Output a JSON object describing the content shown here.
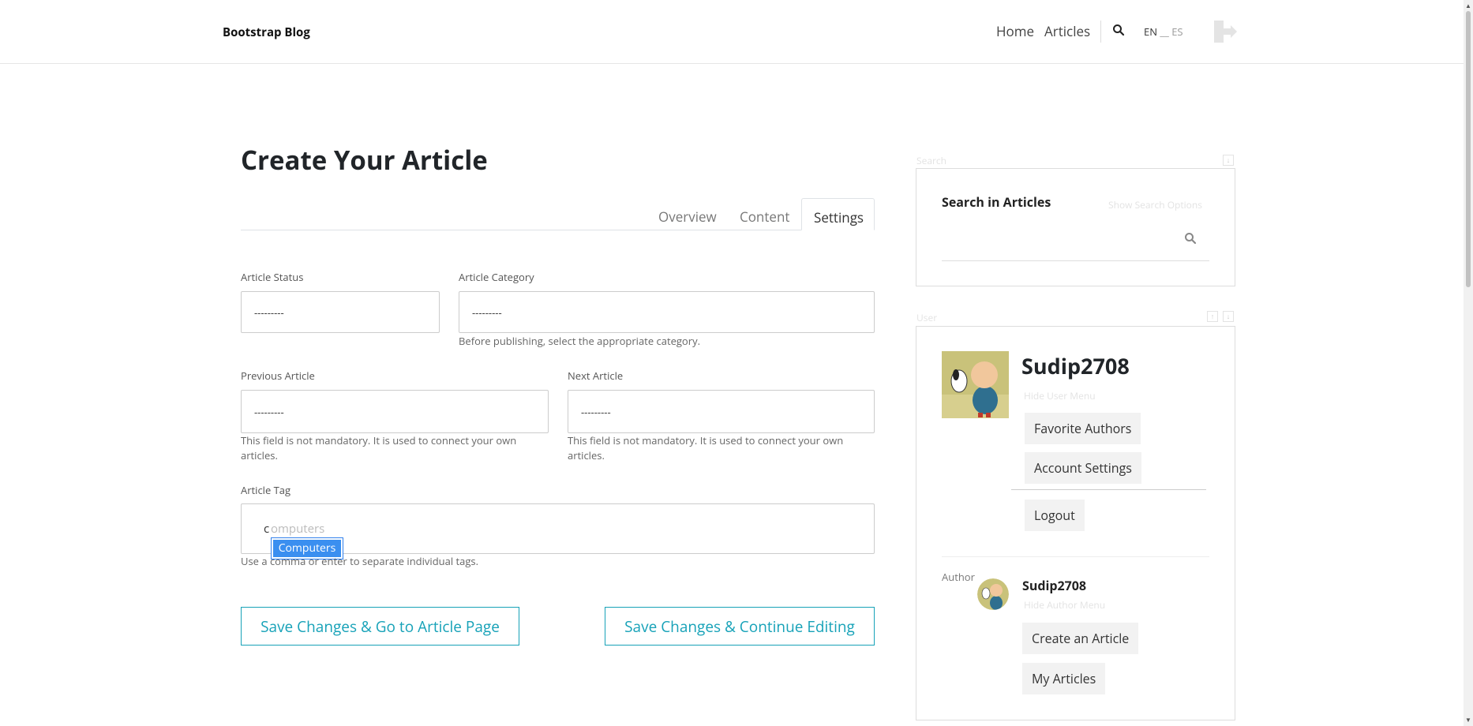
{
  "header": {
    "brand": "Bootstrap Blog",
    "nav": [
      "Home",
      "Articles"
    ],
    "lang_en": "EN",
    "lang_sep": "__",
    "lang_es": "ES"
  },
  "page": {
    "title": "Create Your Article",
    "tabs": [
      "Overview",
      "Content",
      "Settings"
    ],
    "active_tab": "Settings"
  },
  "form": {
    "status_label": "Article Status",
    "status_value": "---------",
    "category_label": "Article Category",
    "category_value": "---------",
    "category_help": "Before publishing, select the appropriate category.",
    "prev_label": "Previous Article",
    "prev_value": "---------",
    "prev_help": "This field is not mandatory. It is used to connect your own articles.",
    "next_label": "Next Article",
    "next_value": "---------",
    "next_help": "This field is not mandatory. It is used to connect your own articles.",
    "tag_label": "Article Tag",
    "tag_typed": "c",
    "tag_ghost": "omputers",
    "tag_suggestion": "Computers",
    "tag_help": "Use a comma or enter to separate individual tags."
  },
  "actions": {
    "save_go": "Save Changes & Go to Article Page",
    "save_continue": "Save Changes & Continue Editing"
  },
  "search_widget": {
    "caption": "Search",
    "title": "Search in Articles",
    "options_link": "Show Search Options"
  },
  "user_widget": {
    "caption": "User",
    "username": "Sudip2708",
    "hide_user_menu": "Hide User Menu",
    "menu": [
      "Favorite Authors",
      "Account Settings"
    ],
    "logout": "Logout",
    "author_label": "Author",
    "author_name": "Sudip2708",
    "hide_author_menu": "Hide Author Menu",
    "author_menu": [
      "Create an Article",
      "My Articles"
    ]
  },
  "colors": {
    "accent": "#17a2b8",
    "suggest_bg": "#3a8ff0"
  }
}
